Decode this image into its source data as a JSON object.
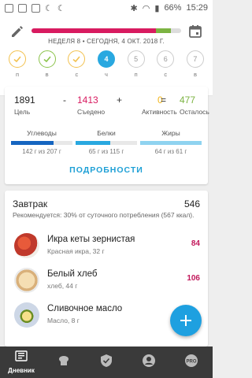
{
  "status_bar": {
    "battery": "66%",
    "time": "15:29"
  },
  "header": {
    "week_label": "НЕДЕЛЯ 8  •  СЕГОДНЯ, 4 ОКТ. 2018 Г.",
    "progress_fraction_red": 0.83,
    "progress_fraction_green": 0.1,
    "colors": {
      "red": "#d81b60",
      "green": "#7cb342",
      "accent": "#29a8e0"
    }
  },
  "week_days": [
    {
      "label": "п",
      "state": "check-yellow"
    },
    {
      "label": "в",
      "state": "check-green"
    },
    {
      "label": "с",
      "state": "check-yellow"
    },
    {
      "label": "ч",
      "number": "4",
      "state": "active"
    },
    {
      "label": "п",
      "number": "5",
      "state": "future"
    },
    {
      "label": "с",
      "number": "6",
      "state": "future"
    },
    {
      "label": "в",
      "number": "7",
      "state": "future"
    }
  ],
  "summary": {
    "goal": {
      "value": "1891",
      "label": "Цель"
    },
    "minus": "-",
    "eaten": {
      "value": "1413",
      "label": "Съедено"
    },
    "plus": "+",
    "activity": {
      "value": "0",
      "label": "Активность"
    },
    "equals": "=",
    "remaining": {
      "value": "477",
      "label": "Осталось"
    },
    "details_button": "ПОДРОБНОСТИ"
  },
  "macros": [
    {
      "name": "Углеводы",
      "value": "142 г из 207 г",
      "fraction": 0.69,
      "color": "#1565c0"
    },
    {
      "name": "Белки",
      "value": "65 г из 115 г",
      "fraction": 0.57,
      "color": "#29a8e0"
    },
    {
      "name": "Жиры",
      "value": "64 г из 61 г",
      "fraction": 1.0,
      "color": "#8fd3f0"
    }
  ],
  "meal": {
    "title": "Завтрак",
    "kcal": "546",
    "recommendation": "Рекомендуется: 30% от суточного потребления (567 ккал).",
    "items": [
      {
        "name": "Икра кеты зернистая",
        "sub": "Красная икра, 32 г",
        "kcal": "84",
        "icon": "red-caviar-image"
      },
      {
        "name": "Белый хлеб",
        "sub": "хлеб, 44 г",
        "kcal": "106",
        "icon": "white-bread-image"
      },
      {
        "name": "Сливочное масло",
        "sub": "Масло, 8 г",
        "kcal": "",
        "icon": "butter-image"
      }
    ]
  },
  "bottom_nav": [
    {
      "label": "Дневник",
      "icon": "diary-icon",
      "active": true
    },
    {
      "label": "",
      "icon": "recipes-icon",
      "active": false
    },
    {
      "label": "",
      "icon": "shield-icon",
      "active": false
    },
    {
      "label": "",
      "icon": "profile-icon",
      "active": false
    },
    {
      "label": "",
      "icon": "pro-icon",
      "active": false
    }
  ]
}
